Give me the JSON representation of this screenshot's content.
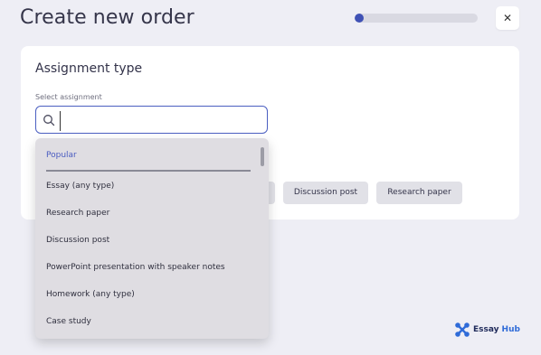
{
  "header": {
    "title": "Create new order",
    "progress_fraction": 0.07,
    "close_glyph": "✕"
  },
  "card": {
    "heading": "Assignment type",
    "field_label": "Select assignment",
    "search": {
      "value": "",
      "placeholder": ""
    },
    "chips": [
      "",
      "Discussion post",
      "Research paper"
    ]
  },
  "dropdown": {
    "section_label": "Popular",
    "items": [
      "Essay (any type)",
      "Research paper",
      "Discussion post",
      "PowerPoint presentation with speaker notes",
      "Homework (any type)",
      "Case study"
    ]
  },
  "brand": {
    "name": "Essay",
    "sub": "Hub"
  },
  "colors": {
    "accent": "#3f51b5",
    "background": "#eeeef5",
    "brand_blue": "#2f6bd8"
  }
}
